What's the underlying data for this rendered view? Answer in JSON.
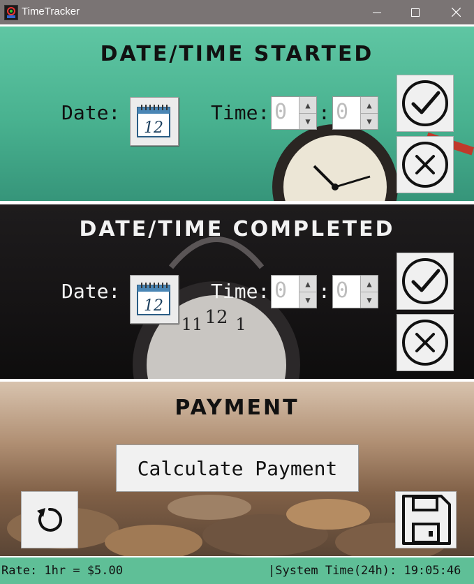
{
  "window": {
    "title": "TimeTracker"
  },
  "started": {
    "heading": "Date/Time Started",
    "date_label": "Date:",
    "time_label": "Time:",
    "hour": "0",
    "minute": "0",
    "separator": ":"
  },
  "completed": {
    "heading": "Date/Time Completed",
    "date_label": "Date:",
    "time_label": "Time:",
    "hour": "0",
    "minute": "0",
    "separator": ":"
  },
  "payment": {
    "heading": "Payment",
    "calculate_label": "Calculate Payment"
  },
  "status": {
    "rate": "Rate: 1hr = $5.00",
    "system_time": "|System Time(24h): 19:05:46"
  },
  "calendar_day": "12",
  "icons": [
    "calendar-icon",
    "check-icon",
    "cancel-icon",
    "refresh-icon",
    "save-icon"
  ]
}
